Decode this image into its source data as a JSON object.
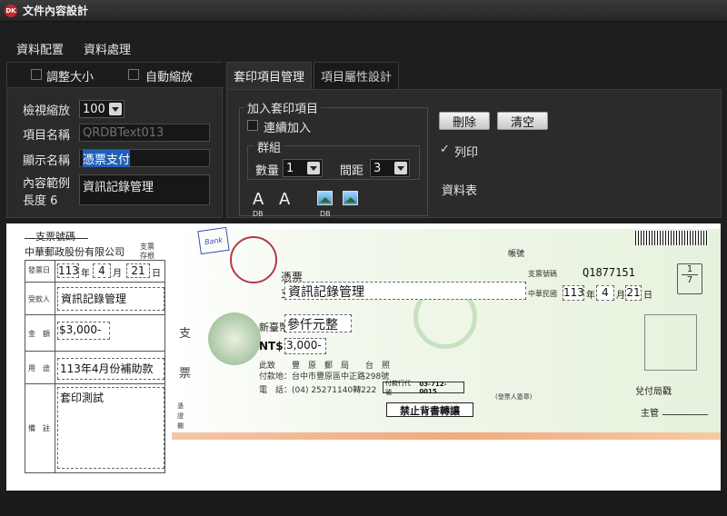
{
  "window": {
    "title": "文件內容設計",
    "app_icon_text": "DK"
  },
  "menu": {
    "items": [
      "資料配置",
      "資料處理"
    ]
  },
  "left_panel": {
    "resize_label": "調整大小",
    "autozoom_label": "自動縮放",
    "zoom_label": "檢視縮放",
    "zoom_value": "100",
    "item_name_label": "項目名稱",
    "item_name_value": "QRDBText013",
    "display_name_label": "顯示名稱",
    "display_name_value": "憑票支付",
    "content_label": "內容範例",
    "length_label": "長度 6",
    "content_value": "資訊記錄管理"
  },
  "tabs": {
    "tab1": "套印項目管理",
    "tab2": "項目屬性設計"
  },
  "right_panel": {
    "group_title": "加入套印項目",
    "continuous_label": "連續加入",
    "subgroup_title": "群組",
    "qty_label": "數量",
    "qty_value": "1",
    "spacing_label": "間距",
    "spacing_value": "3",
    "delete_btn": "刪除",
    "clear_btn": "清空",
    "print_check": "✓",
    "print_label": "列印",
    "datasheet_label": "資料表",
    "fontA1": "A",
    "fontA2": "A",
    "db1": "DB",
    "db2": "DB"
  },
  "stub": {
    "cheque_no_label": "支票號碼",
    "bank_name": "中華郵政股份有限公司",
    "stub_label_top": "支票",
    "stub_label_bottom": "存根",
    "date_label": "發票日",
    "date_year": "113",
    "date_month": "4",
    "date_day": "21",
    "y_char": "年",
    "m_char": "月",
    "d_char": "日",
    "payee_label": "受款人",
    "payee_value": "資訊記錄管理",
    "amount_label": "金　額",
    "amount_value": "$3,000-",
    "purpose_label": "用　途",
    "purpose_value": "113年4月份補助款",
    "remark_label": "備　註",
    "remark_value": "套印測試"
  },
  "cheque": {
    "pay_line1": "憑票",
    "pay_line2": "支付",
    "payee_value": "資訊記錄管理",
    "account_label": "帳號",
    "cheque_no_label": "支票號碼",
    "cheque_no_value": "Q1877151",
    "roc_label": "中華民國",
    "date_year": "113",
    "date_month": "4",
    "date_day": "21",
    "y_char": "年",
    "m_char": "月",
    "d_char": "日",
    "fraction_num": "1",
    "fraction_den": "7",
    "ntd_label": "新臺幣",
    "amount_words": "參仟元整",
    "ntd_sign": "NT$",
    "amount_value": "3,000-",
    "side_char1": "支",
    "side_char2": "票",
    "payer_line": "此致　　豐　原　郵　局　　台　照",
    "address_line": "付款地：台中市豐原區中正路298號",
    "phone_line": "電　話：(04) 25271140轉222",
    "agent_label": "付款行代號",
    "agent_value": "03-712-0015",
    "signature_label": "(發票人簽章)",
    "cashier_label": "兌付局戳",
    "supervisor_label": "主管",
    "no_endorse": "禁止背書轉讓",
    "left_label1": "憑",
    "left_label2": "證",
    "left_label3": "欄",
    "stamp_text": "Bank"
  }
}
